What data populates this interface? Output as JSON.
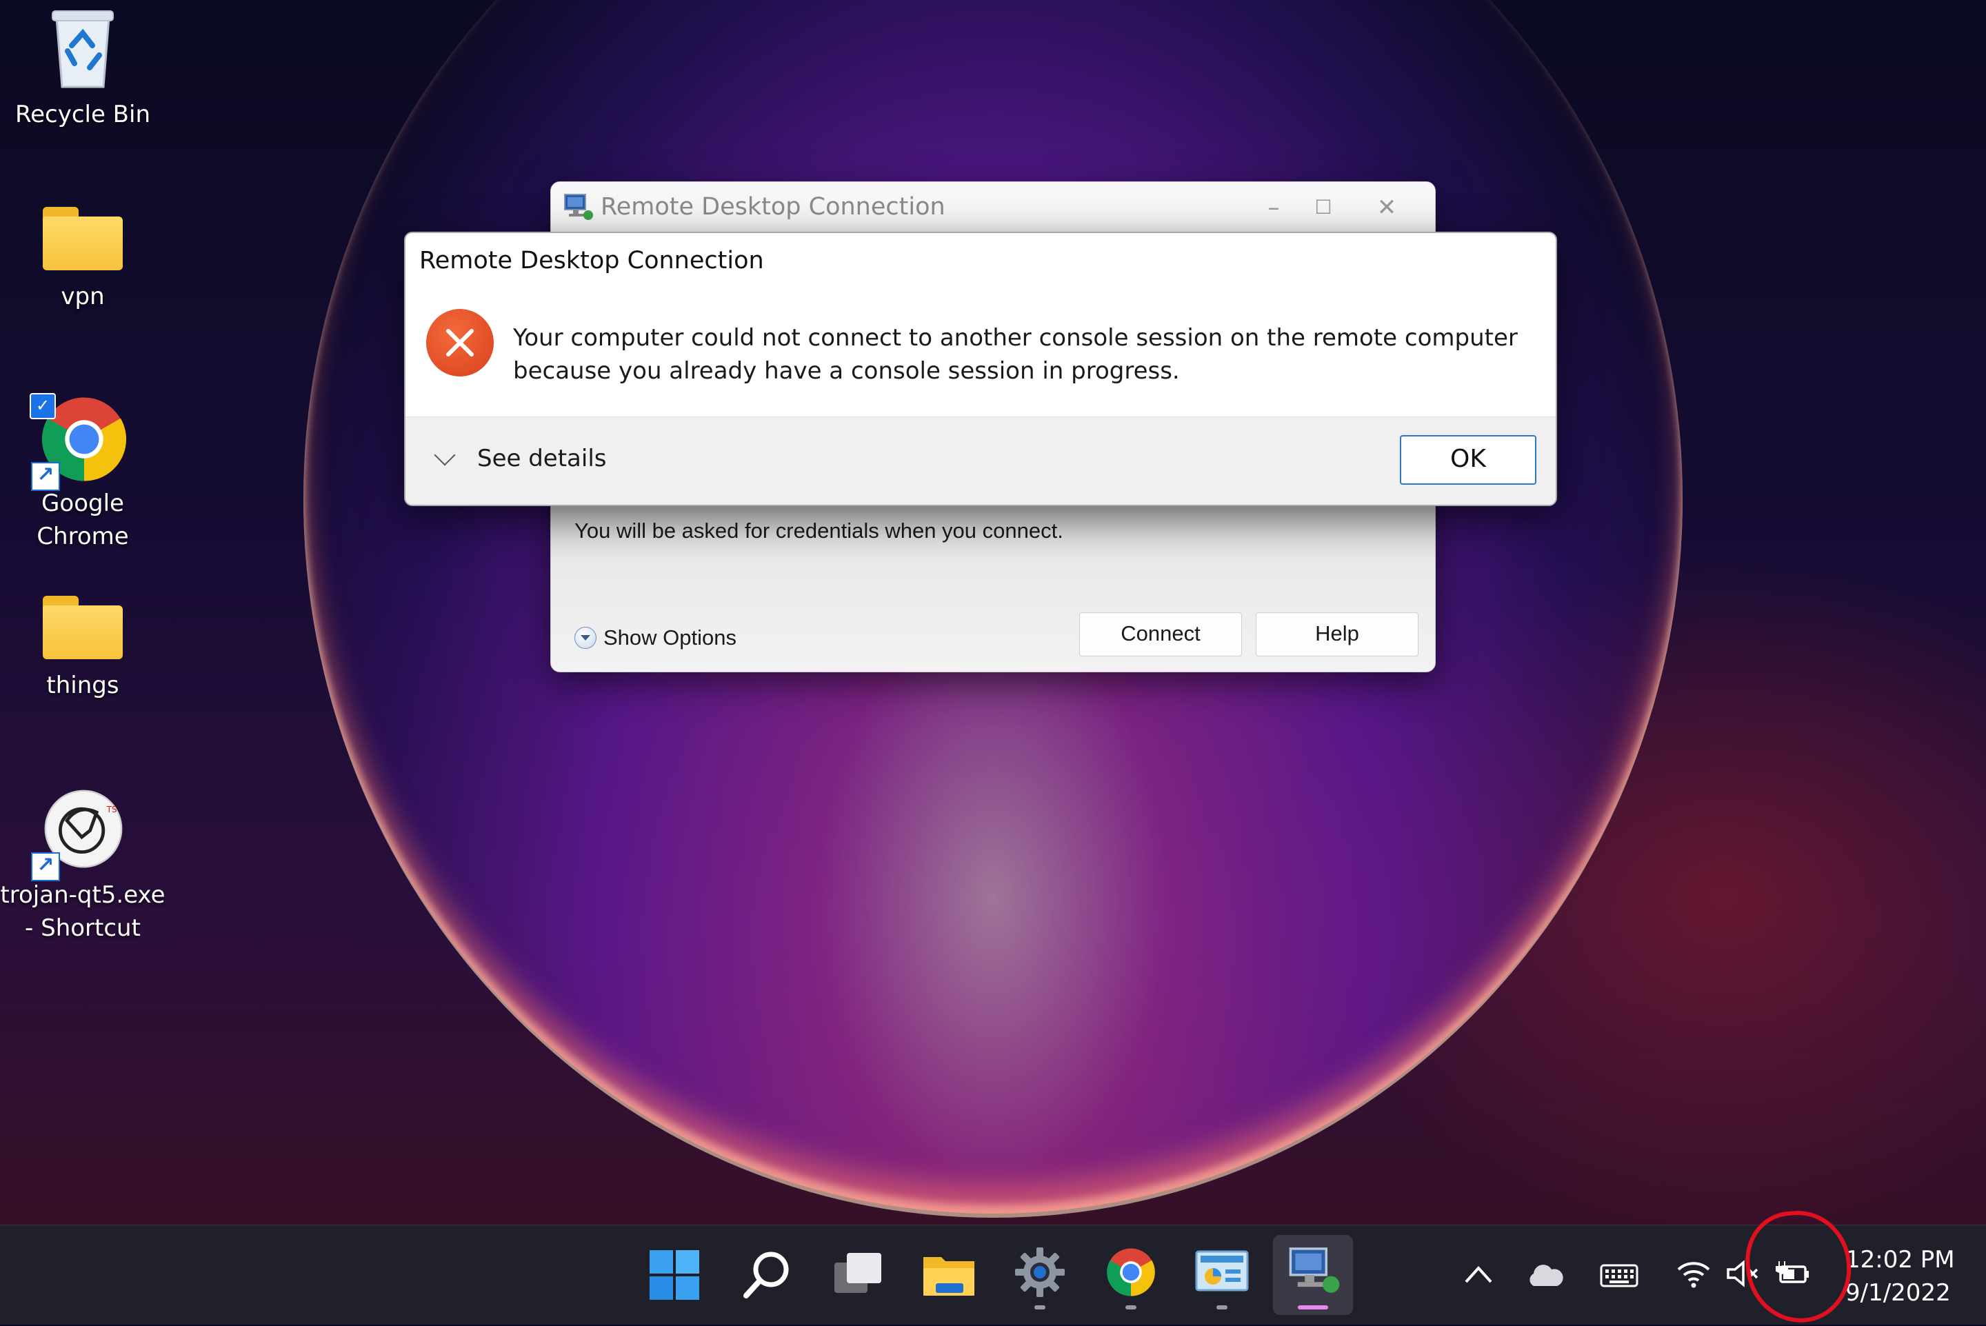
{
  "desktop": {
    "icons": [
      {
        "label": "Recycle Bin",
        "icon": "recycle-bin-icon"
      },
      {
        "label": "vpn",
        "icon": "folder-icon"
      },
      {
        "label_line1": "Google",
        "label_line2": "Chrome",
        "icon": "chrome-icon",
        "shortcut": true,
        "selected_checkbox": true
      },
      {
        "label": "things",
        "icon": "folder-icon"
      },
      {
        "label_line1": "trojan-qt5.exe",
        "label_line2": "- Shortcut",
        "icon": "trojan-app-icon",
        "shortcut": true
      }
    ]
  },
  "rdc_window": {
    "title": "Remote Desktop Connection",
    "credentials_note": "You will be asked for credentials when you connect.",
    "show_options": "Show Options",
    "connect": "Connect",
    "help": "Help",
    "minimize_glyph": "–",
    "maximize_glyph": "☐",
    "close_glyph": "✕"
  },
  "error_dialog": {
    "title": "Remote Desktop Connection",
    "message_line1": "Your computer could not connect to another console session on the remote computer",
    "message_line2": "because you already have a console session in progress.",
    "see_details": "See details",
    "ok": "OK",
    "accent_color": "#2c77c6",
    "error_color": "#e04a24"
  },
  "taskbar": {
    "apps": [
      {
        "name": "start",
        "icon": "windows-start-icon"
      },
      {
        "name": "search",
        "icon": "search-icon"
      },
      {
        "name": "task-view",
        "icon": "task-view-icon"
      },
      {
        "name": "file-explorer",
        "icon": "folder-icon"
      },
      {
        "name": "settings",
        "icon": "gear-icon",
        "running": true
      },
      {
        "name": "chrome",
        "icon": "chrome-icon",
        "running": true
      },
      {
        "name": "control-panel",
        "icon": "control-panel-icon",
        "running": true
      },
      {
        "name": "remote-desktop",
        "icon": "remote-desktop-icon",
        "active": true
      }
    ],
    "tray": [
      "chevron-up-icon",
      "onedrive-cloud-icon",
      "keyboard-icon",
      "wifi-icon",
      "volume-muted-icon",
      "battery-charging-icon"
    ],
    "time": "12:02 PM",
    "date": "9/1/2022"
  },
  "annotation": {
    "color": "#e01020",
    "target": "battery-charging-icon"
  }
}
